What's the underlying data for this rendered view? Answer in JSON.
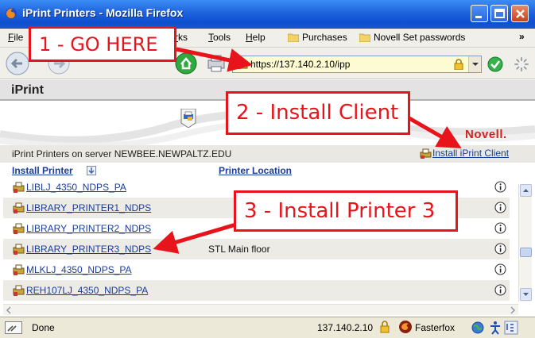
{
  "window": {
    "title": "iPrint Printers - Mozilla Firefox",
    "controls": [
      "minimize-icon",
      "maximize-icon",
      "close-icon"
    ]
  },
  "menu": {
    "file": "File",
    "bookmarks_tail": "rks",
    "tools": "Tools",
    "help": "Help",
    "bookmarks": [
      {
        "label": "Purchases",
        "icon": "folder-icon"
      },
      {
        "label": "Novell Set passwords",
        "icon": "folder-icon"
      }
    ],
    "more": "»"
  },
  "navigation": {
    "url": "https://137.140.2.10/ipp",
    "url_background": "#fdfbd2"
  },
  "page": {
    "header_title": "iPrint",
    "brand_logo": "Novell.",
    "server_text": "iPrint Printers on server NEWBEE.NEWPALTZ.EDU",
    "install_client_label": "Install iPrint Client",
    "columns": {
      "install_printer": "Install Printer",
      "printer_location": "Printer Location"
    },
    "printers": [
      {
        "name": "LIBLJ_4350_NDPS_PA",
        "location": ""
      },
      {
        "name": "LIBRARY_PRINTER1_NDPS",
        "location": ""
      },
      {
        "name": "LIBRARY_PRINTER2_NDPS",
        "location": ""
      },
      {
        "name": "LIBRARY_PRINTER3_NDPS",
        "location": "STL Main floor"
      },
      {
        "name": "MLKLJ_4350_NDPS_PA",
        "location": ""
      },
      {
        "name": "REH107LJ_4350_NDPS_PA",
        "location": ""
      }
    ],
    "link_color": "#1a3c9c"
  },
  "status": {
    "text": "Done",
    "ip": "137.140.2.10",
    "fasterfox": "Fasterfox"
  },
  "annotations": {
    "step1": "1 - GO HERE",
    "step2": "2 - Install Client",
    "step3": "3 - Install Printer 3",
    "color": "#e8141b"
  }
}
